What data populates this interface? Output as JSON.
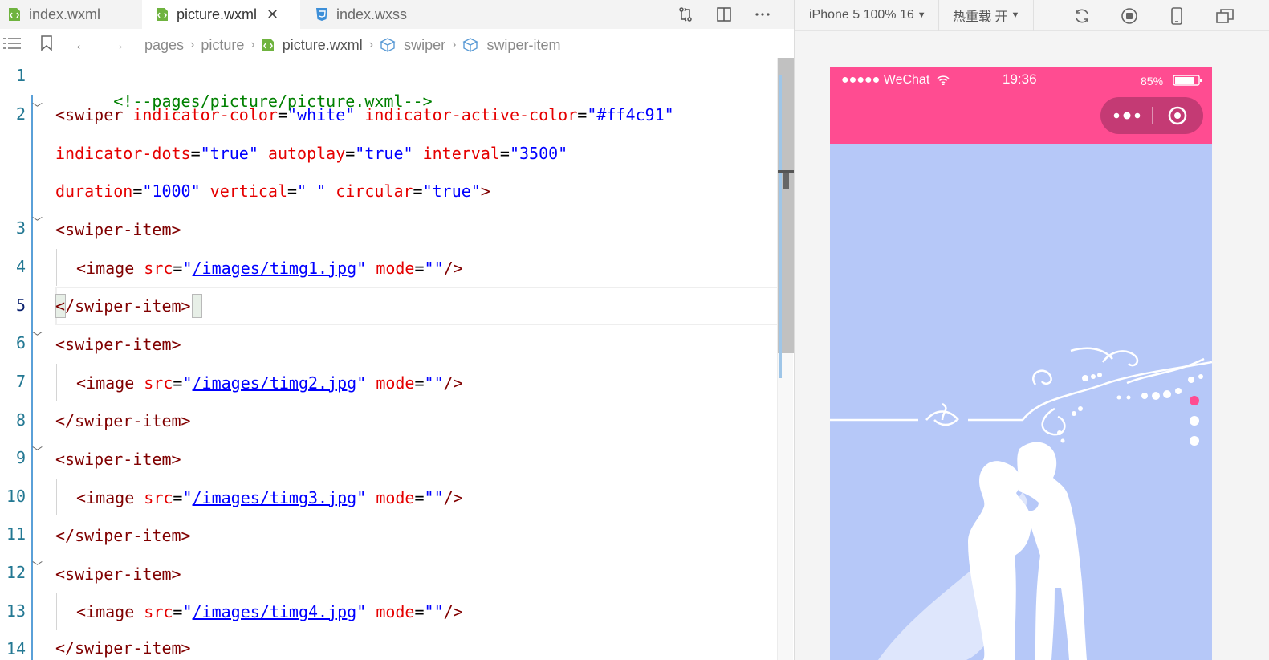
{
  "tabs": [
    {
      "label": "index.wxml",
      "active": false,
      "icon": "wxml-file-icon"
    },
    {
      "label": "picture.wxml",
      "active": true,
      "icon": "wxml-file-icon"
    },
    {
      "label": "index.wxss",
      "active": false,
      "icon": "css-file-icon"
    }
  ],
  "breadcrumb": [
    "pages",
    "picture",
    "picture.wxml",
    "swiper",
    "swiper-item"
  ],
  "code": {
    "line_numbers": [
      "1",
      "2",
      "3",
      "4",
      "5",
      "6",
      "7",
      "8",
      "9",
      "10",
      "11",
      "12",
      "13",
      "14"
    ],
    "comment": "<!--pages/picture/picture.wxml-->",
    "swiper_tag": "<swiper",
    "attr_indicator_color": "indicator-color",
    "val_white": "\"white\"",
    "attr_indicator_active_color": "indicator-active-color",
    "val_active_color": "\"#ff4c91\"",
    "attr_indicator_dots": "indicator-dots",
    "val_true": "\"true\"",
    "attr_autoplay": "autoplay",
    "attr_interval": "interval",
    "val_interval": "\"3500\"",
    "attr_duration": "duration",
    "val_duration": "\"1000\"",
    "attr_vertical": "vertical",
    "val_vertical": "\" \"",
    "attr_circular": "circular",
    "tag_close_gt": ">",
    "swiper_item_open": "<swiper-item>",
    "swiper_item_close": "</swiper-item>",
    "image_open": "<image",
    "attr_src": "src",
    "attr_mode": "mode",
    "val_empty": "\"\"",
    "self_close": "/>",
    "eq": "=",
    "quote": "\"",
    "src_values": [
      "/images/timg1.jpg",
      "/images/timg2.jpg",
      "/images/timg3.jpg",
      "/images/timg4.jpg"
    ]
  },
  "simulator": {
    "device": "iPhone 5 100% 16",
    "hot_reload": "热重载 开",
    "carrier": "●●●●● WeChat",
    "time": "19:36",
    "battery": "85%",
    "nav_color": "#ff4c91",
    "swiper_background": "#b6c8f8",
    "indicator_active_color": "#ff4c91",
    "indicator_color": "white",
    "indicator_count": 3,
    "active_indicator_index": 0
  }
}
